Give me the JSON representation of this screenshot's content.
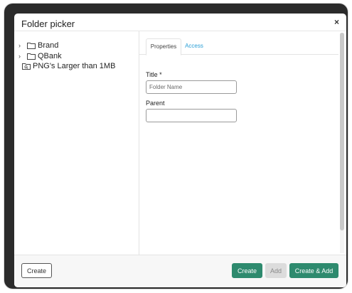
{
  "dialog": {
    "title": "Folder picker",
    "close_label": "×"
  },
  "tree": {
    "items": [
      {
        "label": "Brand",
        "expandable": true,
        "icon": "folder-icon"
      },
      {
        "label": "QBank",
        "expandable": true,
        "icon": "folder-icon"
      },
      {
        "label": "PNG's Larger than 1MB",
        "expandable": false,
        "icon": "smart-folder-icon"
      }
    ]
  },
  "tabs": [
    {
      "label": "Properties",
      "active": true
    },
    {
      "label": "Access",
      "active": false
    }
  ],
  "form": {
    "title_label": "Title *",
    "title_placeholder": "Folder Name",
    "title_value": "",
    "parent_label": "Parent",
    "parent_value": ""
  },
  "footer": {
    "create_outline_label": "Create",
    "create_label": "Create",
    "add_label": "Add",
    "create_add_label": "Create & Add"
  },
  "colors": {
    "primary": "#2e8a6e",
    "link": "#2a9fd6",
    "disabled": "#dcdcdc"
  }
}
